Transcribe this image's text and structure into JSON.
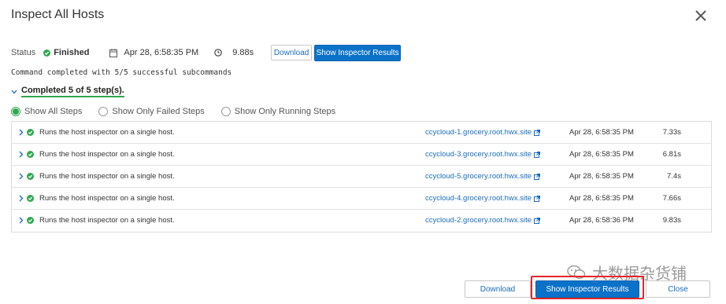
{
  "dialog": {
    "title": "Inspect All Hosts"
  },
  "status": {
    "label": "Status",
    "value": "Finished",
    "time": "Apr 28, 6:58:35 PM",
    "duration": "9.88s",
    "download_label": "Download",
    "show_results_label": "Show Inspector Results"
  },
  "command_message": "Command completed with 5/5 successful subcommands",
  "completed_label": "Completed 5 of 5 step(s).",
  "filters": [
    "Show All Steps",
    "Show Only Failed Steps",
    "Show Only Running Steps"
  ],
  "selected_filter": "Show All Steps",
  "steps": [
    {
      "desc": "Runs the host inspector on a single host.",
      "host": "ccycloud-1.grocery.root.hwx.site",
      "time": "Apr 28, 6:58:35 PM",
      "duration": "7.33s"
    },
    {
      "desc": "Runs the host inspector on a single host.",
      "host": "ccycloud-3.grocery.root.hwx.site",
      "time": "Apr 28, 6:58:35 PM",
      "duration": "6.81s"
    },
    {
      "desc": "Runs the host inspector on a single host.",
      "host": "ccycloud-5.grocery.root.hwx.site",
      "time": "Apr 28, 6:58:35 PM",
      "duration": "7.4s"
    },
    {
      "desc": "Runs the host inspector on a single host.",
      "host": "ccycloud-4.grocery.root.hwx.site",
      "time": "Apr 28, 6:58:35 PM",
      "duration": "7.66s"
    },
    {
      "desc": "Runs the host inspector on a single host.",
      "host": "ccycloud-2.grocery.root.hwx.site",
      "time": "Apr 28, 6:58:36 PM",
      "duration": "9.83s"
    }
  ],
  "footer": {
    "download_label": "Download",
    "show_results_label": "Show Inspector Results",
    "close_label": "Close"
  },
  "watermark": "大数据杂货铺",
  "colors": {
    "success": "#2fa84f",
    "primary": "#0b72c9",
    "link": "#1a6bbf",
    "highlight": "#e3262b"
  }
}
